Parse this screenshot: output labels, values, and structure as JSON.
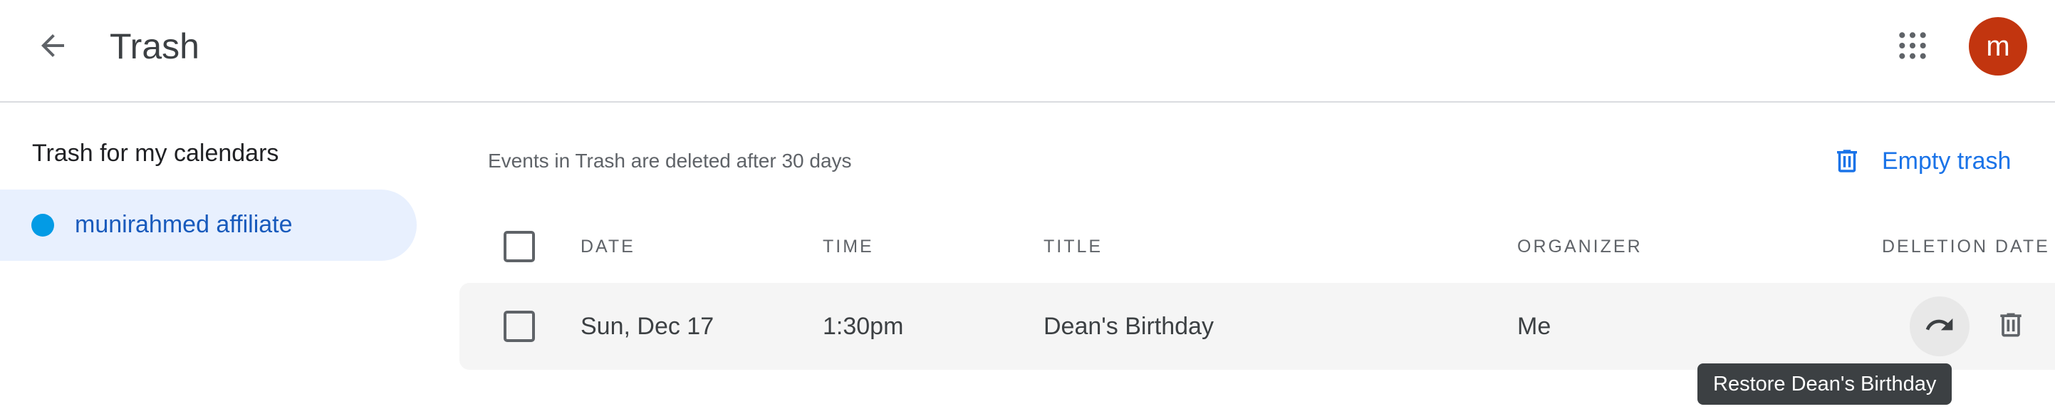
{
  "header": {
    "title": "Trash",
    "back_icon": "arrow-back-icon",
    "apps_icon": "apps-grid-icon",
    "avatar_initial": "m",
    "avatar_color": "#c2350f"
  },
  "sidebar": {
    "heading": "Trash for my calendars",
    "items": [
      {
        "label": "munirahmed affiliate",
        "color": "#039be5",
        "selected": true
      }
    ]
  },
  "main": {
    "info": "Events in Trash are deleted after 30 days",
    "empty_trash_label": "Empty trash",
    "empty_trash_icon": "trash-icon",
    "columns": {
      "date": "DATE",
      "time": "TIME",
      "title": "TITLE",
      "organizer": "ORGANIZER",
      "deletion_date": "DELETION DATE"
    },
    "rows": [
      {
        "date": "Sun, Dec 17",
        "time": "1:30pm",
        "title": "Dean's Birthday",
        "organizer": "Me",
        "checked": false
      }
    ],
    "tooltip": "Restore Dean's Birthday"
  },
  "colors": {
    "accent": "#1a73e8",
    "selected_bg": "#e8f0fe",
    "row_hover_bg": "#f5f5f5"
  }
}
